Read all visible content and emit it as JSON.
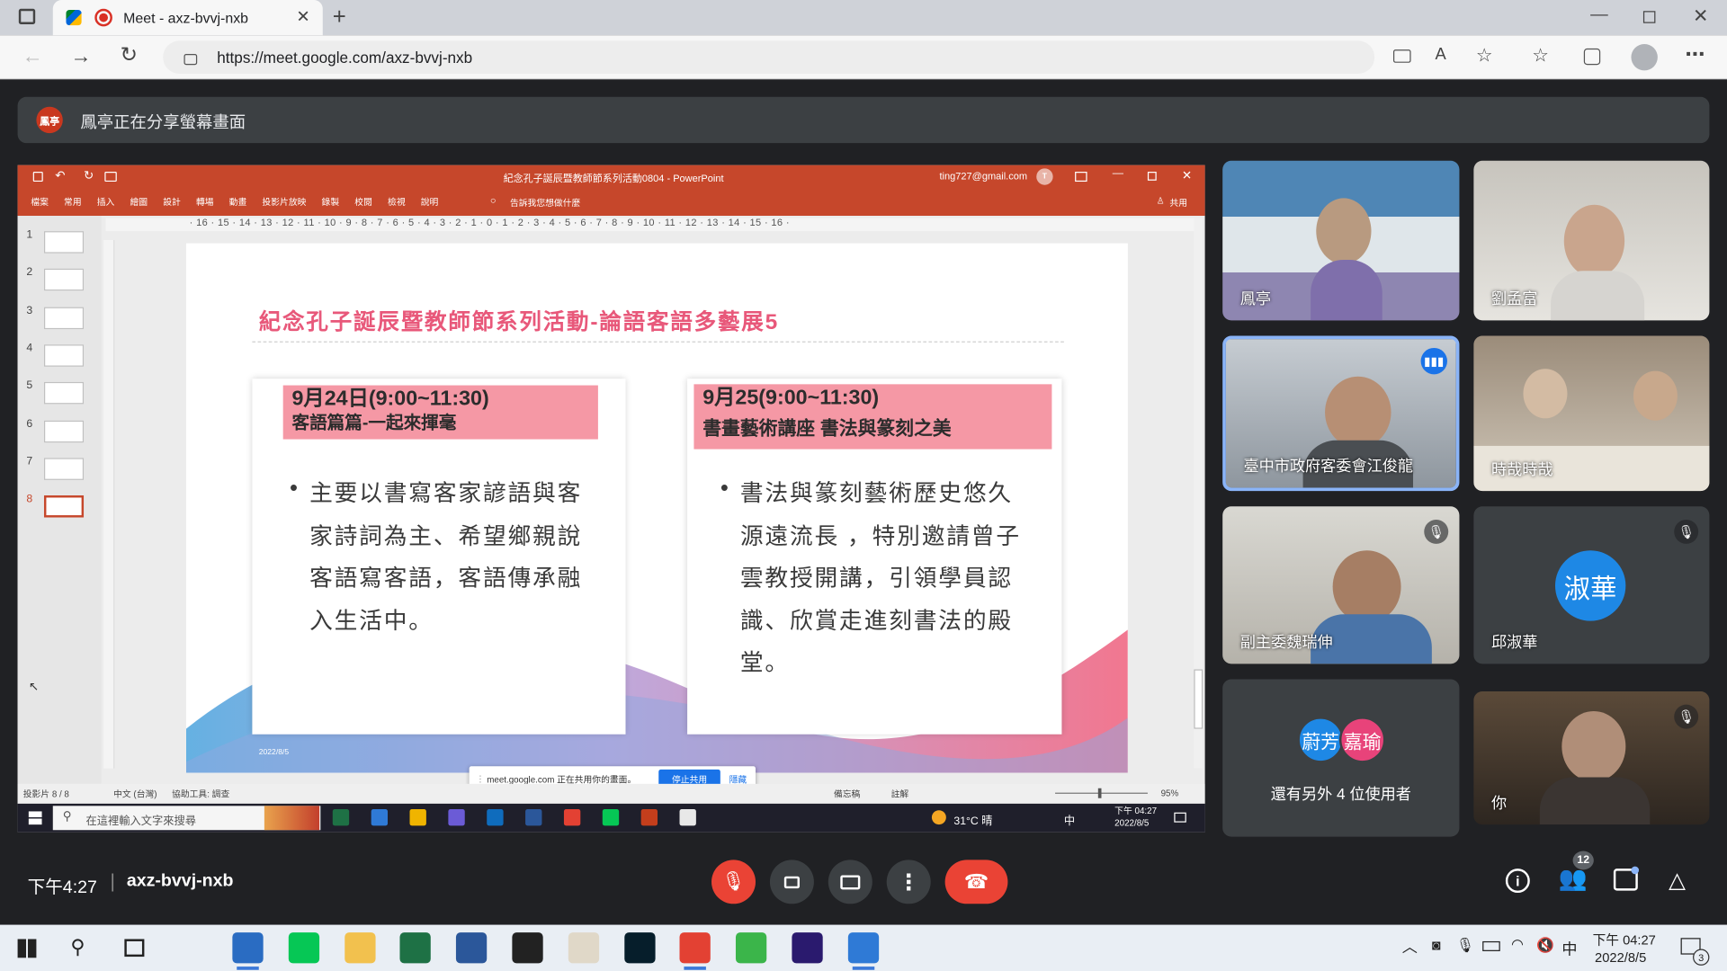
{
  "browser": {
    "tab_title": "Meet - axz-bvvj-nxb",
    "url": "https://meet.google.com/axz-bvvj-nxb"
  },
  "meet": {
    "presenter_avatar": "鳳亭",
    "presenting_banner": "鳳亭正在分享螢幕畫面",
    "time": "下午4:27",
    "separator": "|",
    "meeting_code": "axz-bvvj-nxb",
    "participant_count": "12",
    "others_text": "還有另外 4 位使用者",
    "accent": "#ea4335"
  },
  "participants": [
    {
      "name": "鳳亭",
      "muted": false
    },
    {
      "name": "劉孟富",
      "muted": false
    },
    {
      "name": "臺中市政府客委會江俊龍",
      "muted": false,
      "speaking": true
    },
    {
      "name": "時哉時哉",
      "muted": false
    },
    {
      "name": "副主委魏瑞伸",
      "muted": true
    },
    {
      "name": "邱淑華",
      "initials": "淑華",
      "muted": true
    },
    {
      "name": "你",
      "muted": true
    }
  ],
  "others_avatars": [
    "蔚芳",
    "嘉瑜"
  ],
  "ppt": {
    "title": "紀念孔子誕辰暨教師節系列活動0804 - PowerPoint",
    "account": "ting727@gmail.com",
    "account_initial": "T",
    "ribbon": [
      "檔案",
      "常用",
      "插入",
      "繪圖",
      "設計",
      "轉場",
      "動畫",
      "投影片放映",
      "錄製",
      "校閱",
      "檢視",
      "說明"
    ],
    "tell_me": "告訴我您想做什麼",
    "share_btn": "共用",
    "ruler": "· 16 · 15 · 14 · 13 · 12 · 11 · 10 · 9 · 8 · 7 · 6 · 5 · 4 · 3 · 2 · 1 · 0 · 1 · 2 · 3 · 4 · 5 · 6 · 7 · 8 · 9 · 10 · 11 · 12 · 13 · 14 · 15 · 16 ·",
    "slide_numbers": [
      "1",
      "2",
      "3",
      "4",
      "5",
      "6",
      "7",
      "8"
    ],
    "slide_title": "紀念孔子誕辰暨教師節系列活動-論語客語多藝展5",
    "slide_date": "2022/8/5",
    "card1": {
      "head1": "9月24日(9:00~11:30)",
      "head2": "客語篇篇-一起來揮毫",
      "bullet": "•",
      "lines": [
        "主要以書寫客家諺語與客",
        "家詩詞為主、希望鄉親說",
        "客語寫客語，客語傳承融",
        "入生活中。"
      ]
    },
    "card2": {
      "head1": "9月25(9:00~11:30)",
      "head2": "書畫藝術講座 書法與篆刻之美",
      "bullet": "•",
      "lines": [
        "書法與篆刻藝術歷史悠久",
        "源遠流長 ，特別邀請曾子",
        "雲教授開講，引領學員認",
        "識、欣賞走進刻書法的殿",
        "堂。"
      ]
    },
    "status_left": "投影片 8 / 8",
    "status_lang": "中文 (台灣)",
    "status_access": "協助工具: 調查",
    "status_notes": "備忘稿",
    "status_comments": "註解",
    "zoom": "95%",
    "share_notice": "meet.google.com 正在共用你的畫面。",
    "stop_share": "停止共用",
    "hide": "隱藏"
  },
  "inner_taskbar": {
    "search": "在這裡輸入文字來搜尋",
    "weather": "31°C 晴",
    "ime": "中",
    "time": "下午 04:27",
    "date": "2022/8/5"
  },
  "taskbar": {
    "ime": "中",
    "time": "下午 04:27",
    "date": "2022/8/5",
    "notif": "3"
  }
}
